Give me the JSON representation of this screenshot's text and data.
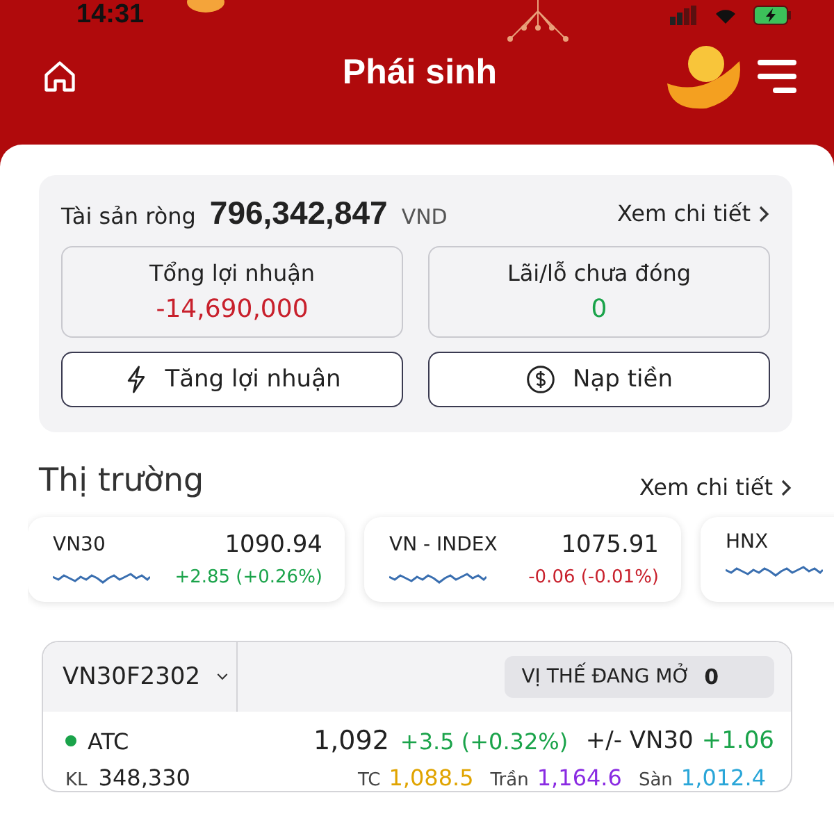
{
  "status_bar": {
    "time": "14:31"
  },
  "header": {
    "title": "Phái sinh"
  },
  "account": {
    "label": "Tài sản ròng",
    "value": "796,342,847",
    "currency": "VND",
    "detail_link": "Xem chi tiết",
    "stats": [
      {
        "label": "Tổng lợi nhuận",
        "value": "-14,690,000",
        "kind": "loss"
      },
      {
        "label": "Lãi/lỗ chưa đóng",
        "value": "0",
        "kind": "gain"
      }
    ],
    "actions": [
      {
        "label": "Tăng lợi nhuận",
        "kind": "boost"
      },
      {
        "label": "Nạp tiền",
        "kind": "deposit"
      }
    ]
  },
  "market": {
    "title": "Thị trường",
    "detail_link": "Xem chi tiết",
    "indices": [
      {
        "name": "VN30",
        "value": "1090.94",
        "change": "+2.85 (+0.26%)",
        "kind": "gain"
      },
      {
        "name": "VN - INDEX",
        "value": "1075.91",
        "change": "-0.06 (-0.01%)",
        "kind": "loss"
      },
      {
        "name": "HNX"
      }
    ]
  },
  "contract": {
    "symbol": "VN30F2302",
    "open_positions_label": "VỊ THẾ ĐANG MỞ",
    "open_positions": "0",
    "session": "ATC",
    "price": "1,092",
    "change": "+3.5 (+0.32%)",
    "basis_label": "+/- VN30",
    "basis": "+1.06",
    "volume_label": "KL",
    "volume": "348,330",
    "levels": [
      {
        "label": "TC",
        "value": "1,088.5",
        "kind": "reference"
      },
      {
        "label": "Trần",
        "value": "1,164.6",
        "kind": "ceiling"
      },
      {
        "label": "Sàn",
        "value": "1,012.4",
        "kind": "floor"
      }
    ]
  }
}
